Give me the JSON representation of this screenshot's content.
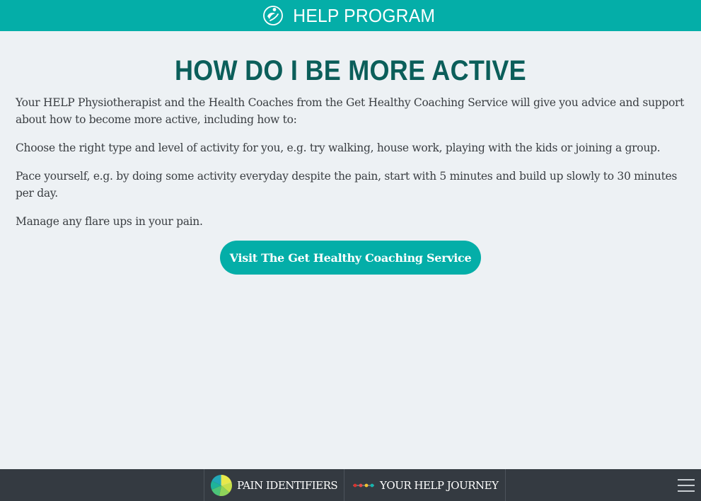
{
  "header": {
    "title": "HELP PROGRAM",
    "logo_icon": "leaf-person-icon"
  },
  "main": {
    "title": "HOW DO I BE MORE ACTIVE",
    "paragraphs": [
      "Your HELP Physiotherapist and the Health Coaches from the Get Healthy Coaching Service will give you advice and support about how to become more active, including how to:",
      "Choose the right type and level of activity for you, e.g. try walking,  house work, playing with the kids or joining a group.",
      "Pace yourself, e.g. by doing some  activity everyday despite the pain,  start with 5 minutes and build up  slowly to 30 minutes per day.",
      "Manage any flare ups in your pain."
    ],
    "cta_label": "Visit The Get Healthy Coaching Service"
  },
  "footer": {
    "nav": [
      {
        "label": "PAIN IDENTIFIERS",
        "icon": "pain-wheel-icon"
      },
      {
        "label": "YOUR HELP JOURNEY",
        "icon": "journey-dots-icon"
      }
    ],
    "menu_icon": "hamburger-menu-icon"
  },
  "colors": {
    "brand_teal": "#04aea8",
    "title_teal": "#0b5e5a",
    "background": "#edf1f4",
    "footer_bg": "#343a41",
    "text": "#3a3e42"
  }
}
